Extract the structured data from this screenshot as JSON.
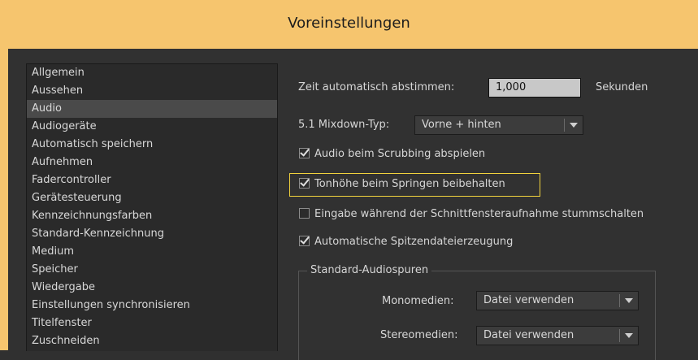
{
  "window": {
    "title": "Voreinstellungen"
  },
  "sidebar": {
    "selected": "Audio",
    "items": [
      "Allgemein",
      "Aussehen",
      "Audio",
      "Audiogeräte",
      "Automatisch speichern",
      "Aufnehmen",
      "Fadercontroller",
      "Gerätesteuerung",
      "Kennzeichnungsfarben",
      "Standard-Kennzeichnung",
      "Medium",
      "Speicher",
      "Wiedergabe",
      "Einstellungen synchronisieren",
      "Titelfenster",
      "Zuschneiden"
    ]
  },
  "audio": {
    "auto_match_label": "Zeit automatisch abstimmen:",
    "auto_match_value": "1,000",
    "auto_match_unit": "Sekunden",
    "mixdown_label": "5.1 Mixdown-Typ:",
    "mixdown_value": "Vorne + hinten",
    "checkboxes": [
      {
        "label": "Audio beim Scrubbing abspielen",
        "checked": true
      },
      {
        "label": "Tonhöhe beim Springen beibehalten",
        "checked": true
      },
      {
        "label": "Eingabe während der Schnittfensteraufnahme stummschalten",
        "checked": false
      },
      {
        "label": "Automatische Spitzendateierzeugung",
        "checked": true
      }
    ],
    "default_tracks": {
      "title": "Standard-Audiospuren",
      "mono_label": "Monomedien:",
      "mono_value": "Datei verwenden",
      "stereo_label": "Stereomedien:",
      "stereo_value": "Datei verwenden"
    }
  },
  "colors": {
    "title_bar": "#f6c56e",
    "panel_bg": "#313131",
    "highlight_border": "#f1d23d"
  }
}
